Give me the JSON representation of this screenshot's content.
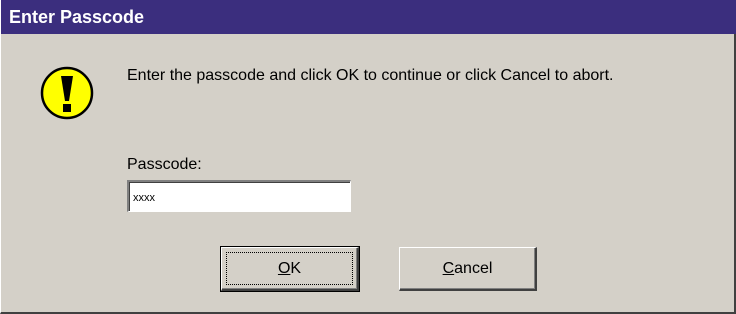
{
  "window": {
    "title": "Enter Passcode"
  },
  "dialog": {
    "icon": "warning-exclamation-icon",
    "message": "Enter the passcode and click OK to continue or click Cancel to abort.",
    "passcode_label": "Passcode:",
    "passcode_value": "xxxx"
  },
  "buttons": {
    "ok_label_underlined": "O",
    "ok_label_rest": "K",
    "cancel_label_underlined": "C",
    "cancel_label_rest": "ancel"
  },
  "colors": {
    "titlebar": "#3b2e7e",
    "face": "#d4d0c8",
    "icon_yellow": "#ffff00"
  }
}
